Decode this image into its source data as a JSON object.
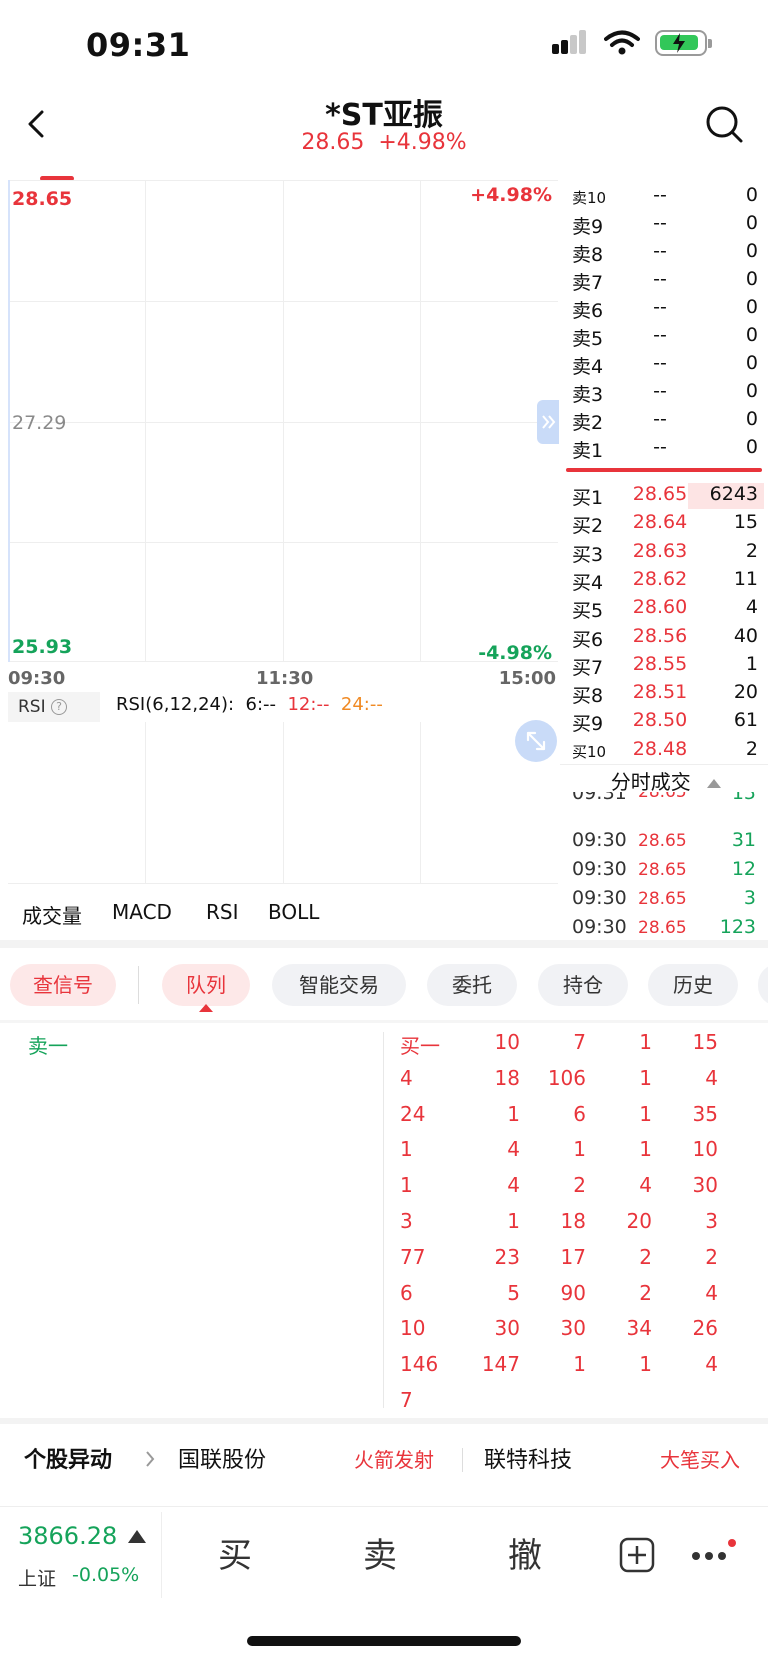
{
  "status": {
    "time": "09:31"
  },
  "header": {
    "title": "*ST亚振",
    "price": "28.65",
    "change": "+4.98%"
  },
  "chart": {
    "price_high": "28.65",
    "price_mid": "27.29",
    "price_low": "25.93",
    "pct_high": "+4.98%",
    "pct_low": "-4.98%",
    "times": [
      "09:30",
      "11:30",
      "15:00"
    ],
    "rsi_tag": "RSI",
    "rsi_params": "RSI(6,12,24):",
    "rsi6": "6:--",
    "rsi12": "12:--",
    "rsi24": "24:--",
    "tabs": [
      "成交量",
      "MACD",
      "RSI",
      "BOLL"
    ]
  },
  "orderbook": {
    "asks": [
      {
        "label": "卖10",
        "price": "--",
        "vol": "0"
      },
      {
        "label": "卖9",
        "price": "--",
        "vol": "0"
      },
      {
        "label": "卖8",
        "price": "--",
        "vol": "0"
      },
      {
        "label": "卖7",
        "price": "--",
        "vol": "0"
      },
      {
        "label": "卖6",
        "price": "--",
        "vol": "0"
      },
      {
        "label": "卖5",
        "price": "--",
        "vol": "0"
      },
      {
        "label": "卖4",
        "price": "--",
        "vol": "0"
      },
      {
        "label": "卖3",
        "price": "--",
        "vol": "0"
      },
      {
        "label": "卖2",
        "price": "--",
        "vol": "0"
      },
      {
        "label": "卖1",
        "price": "--",
        "vol": "0"
      }
    ],
    "bids": [
      {
        "label": "买1",
        "price": "28.65",
        "vol": "6243"
      },
      {
        "label": "买2",
        "price": "28.64",
        "vol": "15"
      },
      {
        "label": "买3",
        "price": "28.63",
        "vol": "2"
      },
      {
        "label": "买4",
        "price": "28.62",
        "vol": "11"
      },
      {
        "label": "买5",
        "price": "28.60",
        "vol": "4"
      },
      {
        "label": "买6",
        "price": "28.56",
        "vol": "40"
      },
      {
        "label": "买7",
        "price": "28.55",
        "vol": "1"
      },
      {
        "label": "买8",
        "price": "28.51",
        "vol": "20"
      },
      {
        "label": "买9",
        "price": "28.50",
        "vol": "61"
      },
      {
        "label": "买10",
        "price": "28.48",
        "vol": "2"
      }
    ],
    "trades_title": "分时成交",
    "trades": [
      {
        "time": "09:31",
        "price": "28.65",
        "vol": "15"
      },
      {
        "time": "09:30",
        "price": "28.65",
        "vol": "31"
      },
      {
        "time": "09:30",
        "price": "28.65",
        "vol": "12"
      },
      {
        "time": "09:30",
        "price": "28.65",
        "vol": "3"
      },
      {
        "time": "09:30",
        "price": "28.65",
        "vol": "123"
      }
    ]
  },
  "segments": [
    "查信号",
    "队列",
    "智能交易",
    "委托",
    "持仓",
    "历史"
  ],
  "queue": {
    "sell_label": "卖一",
    "buy_label": "买一",
    "rows": [
      [
        "买一",
        "10",
        "7",
        "1",
        "15"
      ],
      [
        "4",
        "18",
        "106",
        "1",
        "4"
      ],
      [
        "24",
        "1",
        "6",
        "1",
        "35"
      ],
      [
        "1",
        "4",
        "1",
        "1",
        "10"
      ],
      [
        "1",
        "4",
        "2",
        "4",
        "30"
      ],
      [
        "3",
        "1",
        "18",
        "20",
        "3"
      ],
      [
        "77",
        "23",
        "17",
        "2",
        "2"
      ],
      [
        "6",
        "5",
        "90",
        "2",
        "4"
      ],
      [
        "10",
        "30",
        "30",
        "34",
        "26"
      ],
      [
        "146",
        "147",
        "1",
        "1",
        "4"
      ],
      [
        "7",
        "",
        "",
        "",
        ""
      ]
    ]
  },
  "ticker": {
    "label": "个股异动",
    "items": [
      {
        "name": "国联股份",
        "tag": "火箭发射"
      },
      {
        "name": "联特科技",
        "tag": "大笔买入"
      }
    ]
  },
  "index": {
    "value": "3866.28",
    "name": "上证",
    "change": "-0.05%"
  },
  "bottom": {
    "buy": "买",
    "sell": "卖",
    "cancel": "撤"
  },
  "colors": {
    "up": "#e8343b",
    "down": "#15a35a",
    "accent": "#f08a24"
  }
}
